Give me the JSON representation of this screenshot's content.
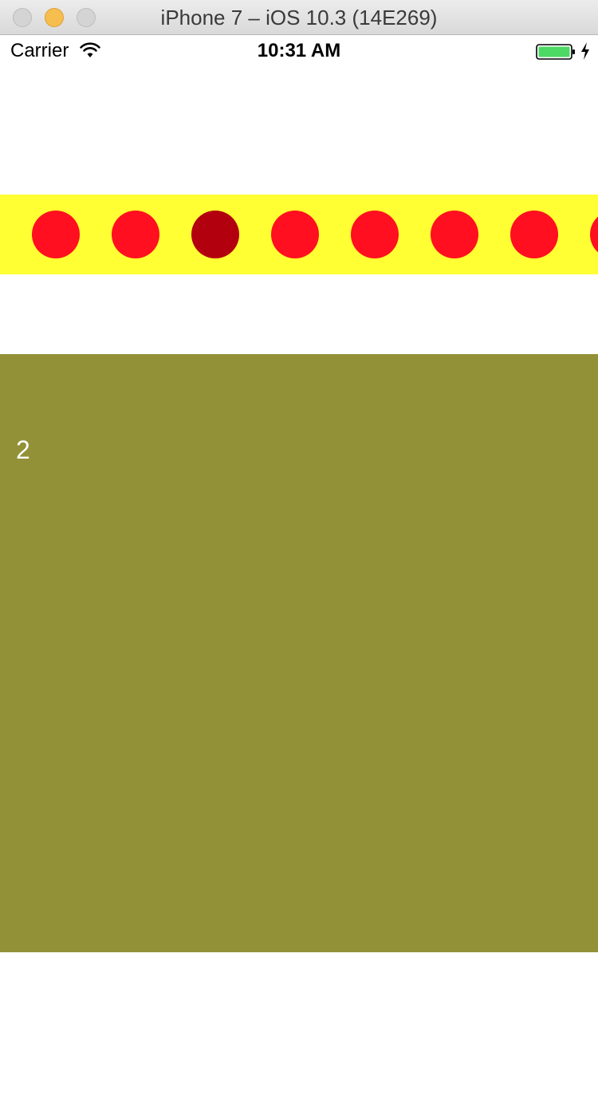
{
  "window": {
    "title": "iPhone 7 – iOS 10.3 (14E269)"
  },
  "status_bar": {
    "carrier": "Carrier",
    "time": "10:31 AM",
    "wifi_icon": "wifi-icon",
    "battery_icon": "battery-icon",
    "charging_icon": "charging-bolt-icon",
    "battery_color": "#4cd964"
  },
  "page_indicator": {
    "background": "#ffff33",
    "dot_color": "#ff0f1f",
    "active_dot_color": "#b3000f",
    "visible_dots": 8,
    "active_index": 2
  },
  "content": {
    "background": "#929137",
    "page_label": "2"
  }
}
